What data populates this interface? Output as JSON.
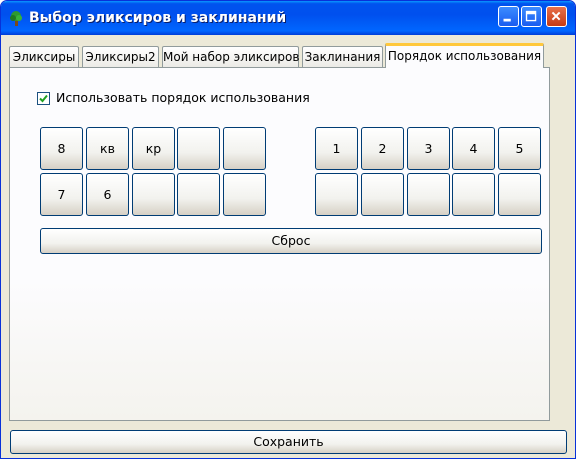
{
  "window": {
    "title": "Выбор эликсиров и заклинаний",
    "accent_color": "#0054e3",
    "buttons": [
      "minimize-icon",
      "maximize-icon",
      "close-icon"
    ]
  },
  "tabs": [
    {
      "label": "Эликсиры",
      "active": false
    },
    {
      "label": "Эликсиры2",
      "active": false
    },
    {
      "label": "Мой набор эликсиров",
      "active": false
    },
    {
      "label": "Заклинания",
      "active": false
    },
    {
      "label": "Порядок использования",
      "active": true
    }
  ],
  "order_panel": {
    "use_order_checkbox": {
      "label": "Использовать порядок использования",
      "checked": true
    },
    "left_grid": {
      "row1": [
        "8",
        "кв",
        "кр",
        "",
        ""
      ],
      "row2": [
        "7",
        "6",
        "",
        "",
        ""
      ]
    },
    "right_grid": {
      "row1": [
        "1",
        "2",
        "3",
        "4",
        "5"
      ],
      "row2": [
        "",
        "",
        "",
        "",
        ""
      ]
    },
    "reset_label": "Сброс"
  },
  "footer": {
    "save_label": "Сохранить"
  }
}
